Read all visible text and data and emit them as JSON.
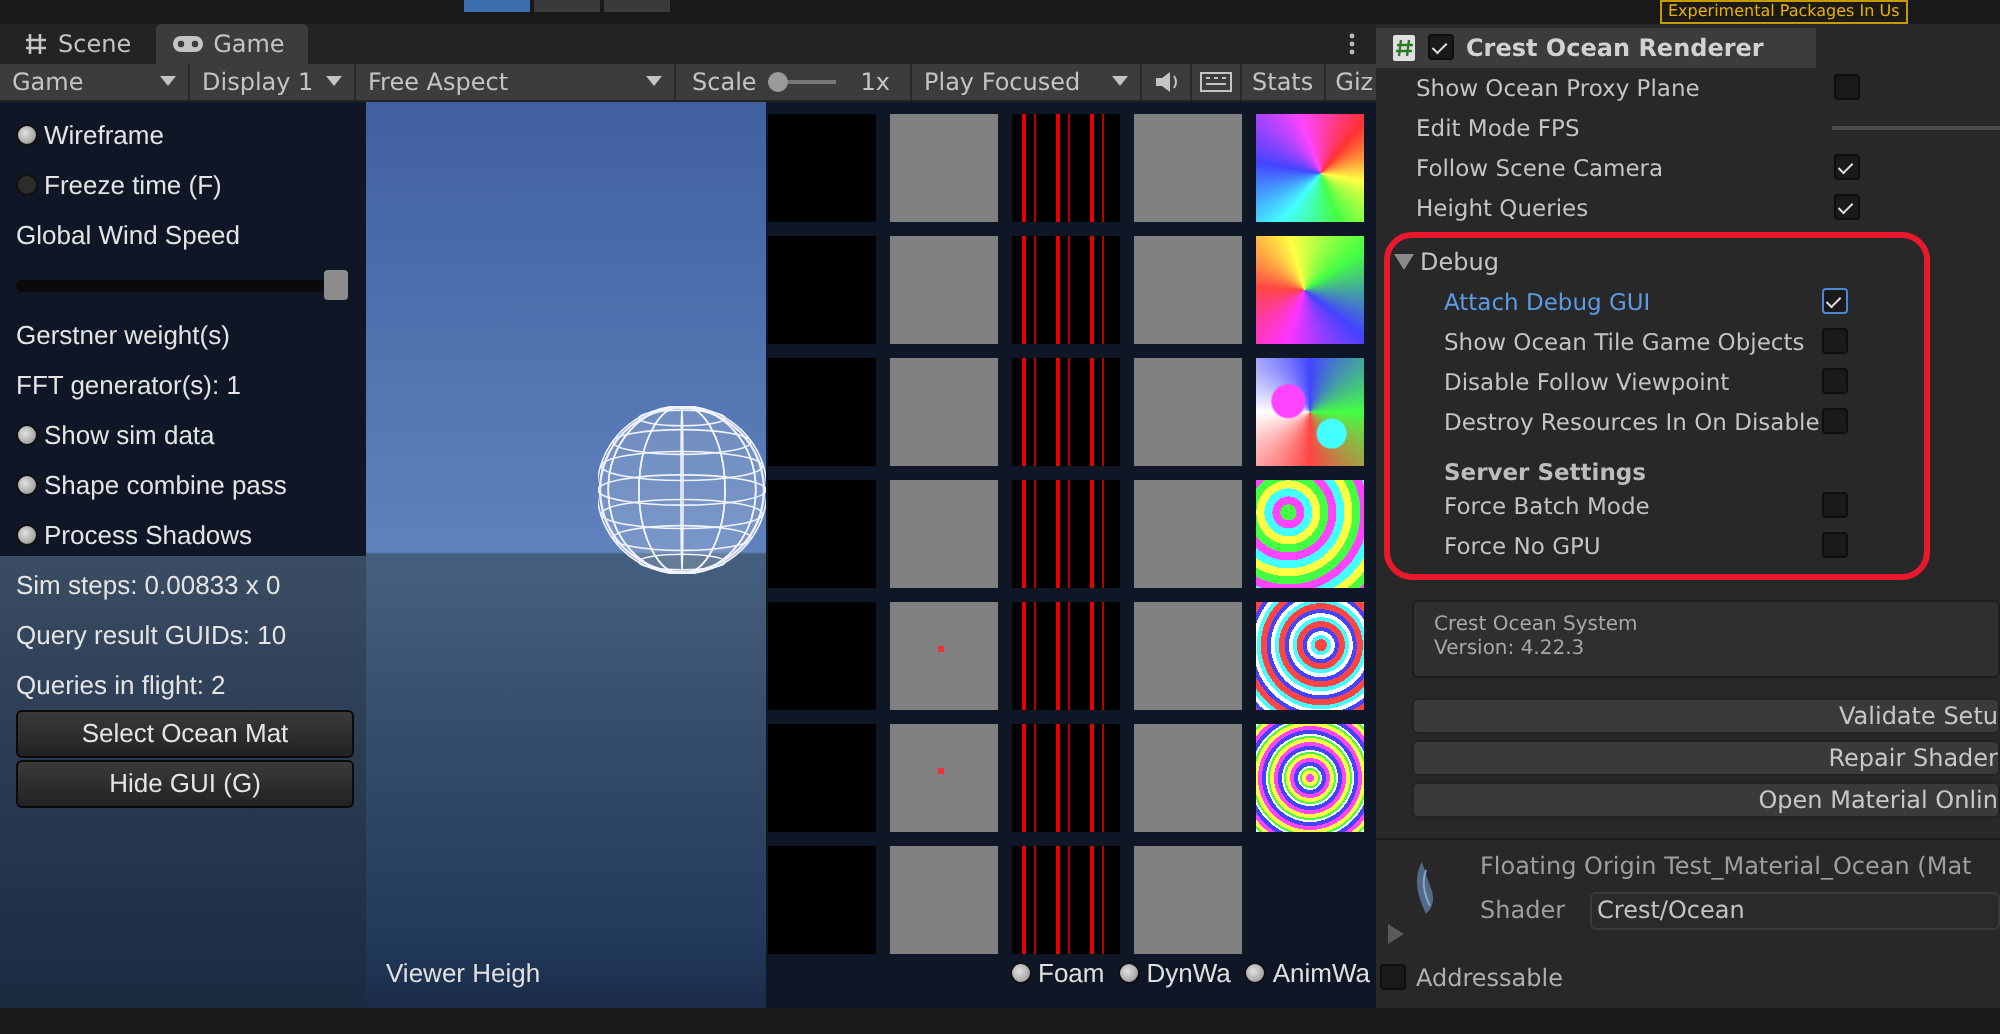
{
  "top_bar": {
    "notice": "Experimental Packages In Us"
  },
  "tabs": [
    {
      "label": "Scene",
      "selected": false
    },
    {
      "label": "Game",
      "selected": true
    }
  ],
  "game_toolbar": {
    "display_mode": "Game",
    "display": "Display 1",
    "aspect": "Free Aspect",
    "scale": {
      "label": "Scale",
      "level": 0,
      "value": "1x"
    },
    "play_mode": "Play Focused",
    "stats": "Stats",
    "gizmos": "Giz"
  },
  "debug_gui": {
    "items": [
      {
        "kind": "toggle",
        "label": "Wireframe",
        "checked": true
      },
      {
        "kind": "toggle",
        "label": "Freeze time (F)",
        "checked": false
      },
      {
        "kind": "label",
        "label": "Global Wind Speed"
      },
      {
        "kind": "slider",
        "level": 1
      },
      {
        "kind": "label",
        "label": "Gerstner weight(s)"
      },
      {
        "kind": "label",
        "label": "FFT generator(s): 1"
      },
      {
        "kind": "toggle",
        "label": "Show sim data",
        "checked": true
      },
      {
        "kind": "toggle",
        "label": "Shape combine pass",
        "checked": true
      },
      {
        "kind": "toggle",
        "label": "Process Shadows",
        "checked": true
      },
      {
        "kind": "label",
        "label": "Sim steps: 0.00833 x 0"
      },
      {
        "kind": "label",
        "label": "Query result GUIDs: 10"
      },
      {
        "kind": "label",
        "label": "Queries in flight: 2"
      },
      {
        "kind": "button",
        "label": "Select Ocean Mat"
      },
      {
        "kind": "button",
        "label": "Hide GUI (G)"
      }
    ]
  },
  "sim_labels": [
    {
      "kind": "text",
      "label": "Viewer Heigh"
    },
    {
      "kind": "toggle",
      "label": "Foam",
      "checked": true
    },
    {
      "kind": "toggle",
      "label": "DynWa",
      "checked": true
    },
    {
      "kind": "toggle",
      "label": "AnimWa",
      "checked": true
    }
  ],
  "inspector": {
    "component": {
      "title": "Crest Ocean Renderer",
      "enabled": true
    },
    "fields": [
      {
        "kind": "checkbox",
        "label": "Show Ocean Proxy Plane",
        "checked": false
      },
      {
        "kind": "slider",
        "label": "Edit Mode FPS"
      },
      {
        "kind": "checkbox",
        "label": "Follow Scene Camera",
        "checked": true
      },
      {
        "kind": "checkbox",
        "label": "Height Queries",
        "checked": true
      }
    ],
    "debug": {
      "label": "Debug",
      "expanded": true,
      "items": [
        {
          "kind": "checkbox",
          "label": "Attach Debug GUI",
          "checked": true,
          "selected": true
        },
        {
          "kind": "checkbox",
          "label": "Show Ocean Tile Game Objects",
          "checked": false,
          "selected": false
        },
        {
          "kind": "checkbox",
          "label": "Disable Follow Viewpoint",
          "checked": false,
          "selected": false
        },
        {
          "kind": "checkbox",
          "label": "Destroy Resources In On Disable",
          "checked": false,
          "selected": false
        },
        {
          "kind": "header",
          "label": "Server Settings",
          "selected": false
        },
        {
          "kind": "checkbox",
          "label": "Force Batch Mode",
          "checked": false,
          "selected": false
        },
        {
          "kind": "checkbox",
          "label": "Force No GPU",
          "checked": false,
          "selected": false
        }
      ]
    },
    "info": [
      "Crest Ocean System",
      "Version: 4.22.3"
    ],
    "buttons": [
      "Validate Setu",
      "Repair Shader",
      "Open Material Onlin"
    ],
    "material": {
      "name": "Floating Origin Test_Material_Ocean (Mat",
      "shader_label": "Shader",
      "shader": "Crest/Ocean"
    },
    "addressable": {
      "label": "Addressable",
      "checked": false
    }
  }
}
